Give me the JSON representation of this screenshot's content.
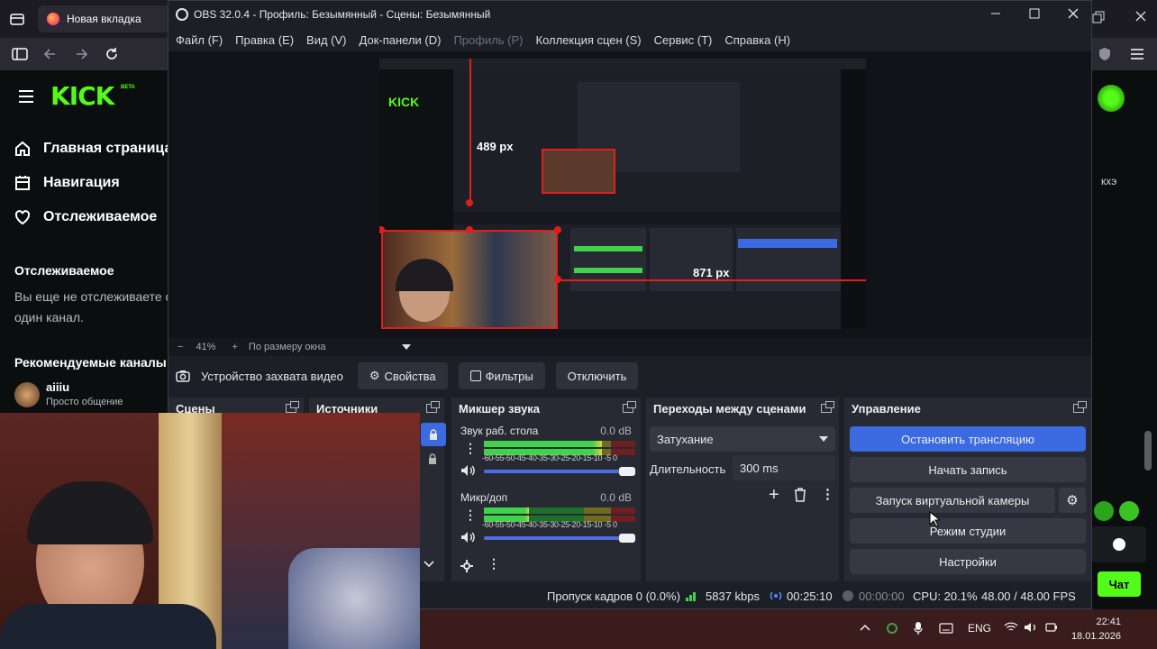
{
  "browser": {
    "tab_title": "Новая вкладка"
  },
  "kick": {
    "logo": "KICK",
    "logo_badge": "BETA",
    "nav": [
      {
        "label": "Главная страница",
        "icon": "home-icon"
      },
      {
        "label": "Навигация",
        "icon": "browse-icon"
      },
      {
        "label": "Отслеживаемое",
        "icon": "heart-icon"
      }
    ],
    "following_heading": "Отслеживаемое",
    "following_empty_line1": "Вы еще не отслеживаете с",
    "following_empty_line2": "один канал.",
    "recommended_heading": "Рекомендуемые каналы",
    "recommended": {
      "name": "aiiiu",
      "category": "Просто общение"
    },
    "chat_snippet": "кхэ",
    "chat_button": "Чат"
  },
  "obs": {
    "title": "OBS 32.0.4 - Профиль: Безымянный - Сцены: Безымянный",
    "menu": [
      {
        "label": "Файл (F)",
        "enabled": true
      },
      {
        "label": "Правка (E)",
        "enabled": true
      },
      {
        "label": "Вид (V)",
        "enabled": true
      },
      {
        "label": "Док-панели (D)",
        "enabled": true
      },
      {
        "label": "Профиль (P)",
        "enabled": false
      },
      {
        "label": "Коллекция сцен (S)",
        "enabled": true
      },
      {
        "label": "Сервис (T)",
        "enabled": true
      },
      {
        "label": "Справка (H)",
        "enabled": true
      }
    ],
    "preview": {
      "measure_top": "489 px",
      "measure_right": "871 px"
    },
    "zoom": {
      "minus": "−",
      "value": "41%",
      "plus": "+",
      "fit": "По размеру окна"
    },
    "source_bar": {
      "source_name": "Устройство захвата видео",
      "properties": "Свойства",
      "filters": "Фильтры",
      "deactivate": "Отключить"
    },
    "docks": {
      "scenes": "Сцены",
      "sources": "Источники",
      "mixer": "Микшер звука",
      "transitions": "Переходы между сценами",
      "controls": "Управление"
    },
    "mixer": {
      "tracks": [
        {
          "name": "Звук раб. стола",
          "db": "0.0 dB",
          "level": 0.78
        },
        {
          "name": "Микр/доп",
          "db": "0.0 dB",
          "level": 0.3
        }
      ],
      "ticks": "-60-55-50-45-40-35-30-25-20-15-10 -5  0"
    },
    "transitions": {
      "type": "Затухание",
      "duration_label": "Длительность",
      "duration_value": "300 ms"
    },
    "controls": {
      "stop_stream": "Остановить трансляцию",
      "start_record": "Начать запись",
      "virtual_cam": "Запуск виртуальной камеры",
      "studio_mode": "Режим студии",
      "settings": "Настройки"
    },
    "status": {
      "dropped": "Пропуск кадров 0 (0.0%)",
      "bitrate": "5837 kbps",
      "stream_time": "00:25:10",
      "record_time": "00:00:00",
      "cpu": "CPU: 20.1%",
      "fps": "48.00 / 48.00 FPS"
    },
    "colors": {
      "accent": "#3c6ae0",
      "panel": "#272a33",
      "window": "#1d1f26"
    }
  },
  "taskbar": {
    "lang": "ENG",
    "time": "22:41",
    "date": "18.01.2026"
  }
}
